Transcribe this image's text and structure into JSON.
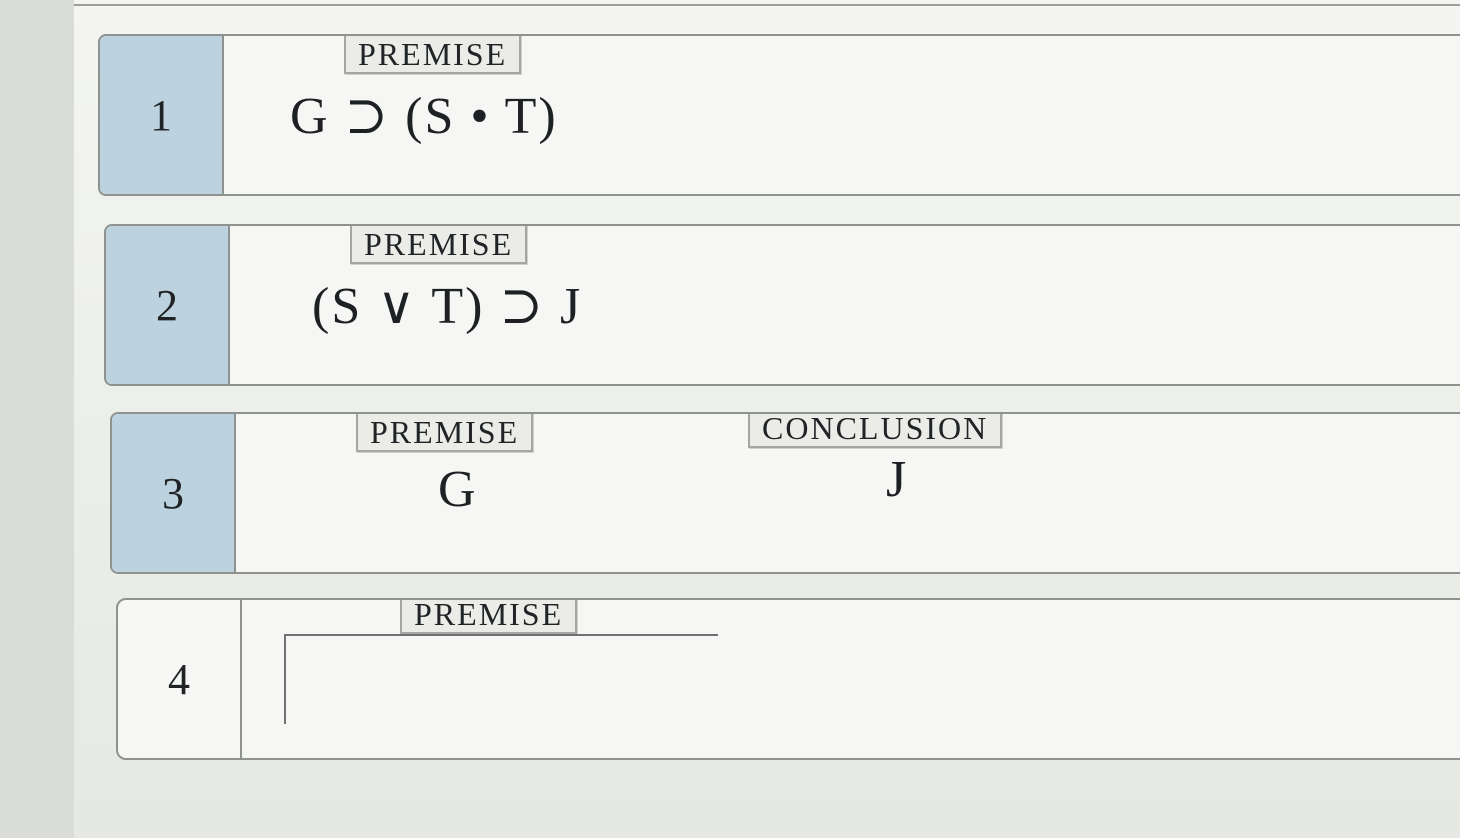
{
  "rows": [
    {
      "number": "1",
      "tag": "PREMISE",
      "formula": "G ⊃ (S • T)"
    },
    {
      "number": "2",
      "tag": "PREMISE",
      "formula": "(S ∨ T) ⊃ J"
    },
    {
      "number": "3",
      "tag": "PREMISE",
      "formula": "G",
      "conclusion_tag": "CONCLUSION",
      "conclusion": "J"
    },
    {
      "number": "4",
      "tag": "PREMISE",
      "input_value": ""
    }
  ]
}
